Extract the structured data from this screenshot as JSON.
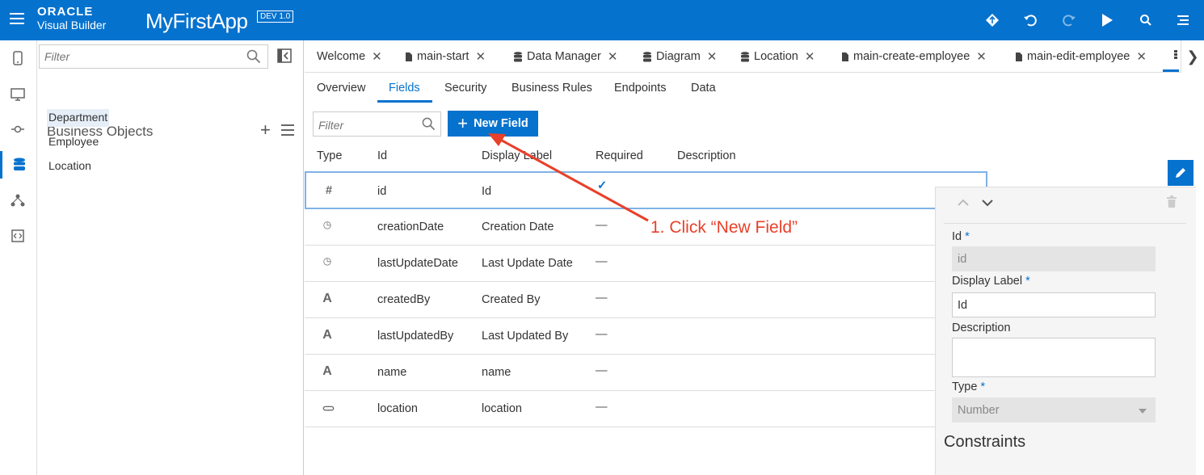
{
  "header": {
    "brand_top": "ORACLE",
    "brand_bottom": "Visual Builder",
    "app_name": "MyFirstApp",
    "badge": "DEV 1.0",
    "icons": [
      "diamond-icon",
      "undo-icon",
      "redo-icon",
      "run-icon",
      "search-icon",
      "menu-icon"
    ]
  },
  "rail": {
    "items": [
      "mobile-apps-icon",
      "web-apps-icon",
      "service-connections-icon",
      "business-objects-icon",
      "processes-icon",
      "source-view-icon"
    ],
    "active": "business-objects-icon"
  },
  "navigator": {
    "filter_placeholder": "Filter",
    "heading": "Business Objects",
    "items": [
      {
        "label": "Department"
      },
      {
        "label": "Employee"
      },
      {
        "label": "Location"
      }
    ],
    "selected": "Department"
  },
  "tabs": [
    {
      "label": "Welcome",
      "icon": ""
    },
    {
      "label": "main-start",
      "icon": "page-icon"
    },
    {
      "label": "Data Manager",
      "icon": "database-icon"
    },
    {
      "label": "Diagram",
      "icon": "database-icon"
    },
    {
      "label": "Location",
      "icon": "database-icon"
    },
    {
      "label": "main-create-employee",
      "icon": "page-icon"
    },
    {
      "label": "main-edit-employee",
      "icon": "page-icon"
    }
  ],
  "subtabs": [
    "Overview",
    "Fields",
    "Security",
    "Business Rules",
    "Endpoints",
    "Data"
  ],
  "active_subtab": "Fields",
  "fields_filter_placeholder": "Filter",
  "new_field_label": "New Field",
  "table": {
    "headers": [
      "Type",
      "Id",
      "Display Label",
      "Required",
      "Description"
    ],
    "rows": [
      {
        "type_icon": "number-icon",
        "id": "id",
        "label": "Id",
        "required": "✓",
        "description": ""
      },
      {
        "type_icon": "datetime-icon",
        "id": "creationDate",
        "label": "Creation Date",
        "required": "—",
        "description": ""
      },
      {
        "type_icon": "datetime-icon",
        "id": "lastUpdateDate",
        "label": "Last Update Date",
        "required": "—",
        "description": ""
      },
      {
        "type_icon": "string-icon",
        "id": "createdBy",
        "label": "Created By",
        "required": "—",
        "description": ""
      },
      {
        "type_icon": "string-icon",
        "id": "lastUpdatedBy",
        "label": "Last Updated By",
        "required": "—",
        "description": ""
      },
      {
        "type_icon": "string-icon",
        "id": "name",
        "label": "name",
        "required": "—",
        "description": ""
      },
      {
        "type_icon": "reference-icon",
        "id": "location",
        "label": "location",
        "required": "—",
        "description": ""
      }
    ]
  },
  "glyphs": {
    "number": "#",
    "string": "A",
    "datetime": "◷",
    "reference": "⊂⊃",
    "plus": "+",
    "close": "✕",
    "chevron_right": "❯",
    "asterisk": "*"
  },
  "panel": {
    "id_label": "Id",
    "id_value": "id",
    "display_label_label": "Display Label",
    "display_label_value": "Id",
    "description_label": "Description",
    "description_value": "",
    "type_label": "Type",
    "type_value": "Number",
    "constraints_heading": "Constraints"
  },
  "annotation": {
    "text": "1. Click “New Field”",
    "color": "#e8402a"
  },
  "colors": {
    "brand": "#0572ce",
    "selection_border": "#7fb2e6"
  }
}
